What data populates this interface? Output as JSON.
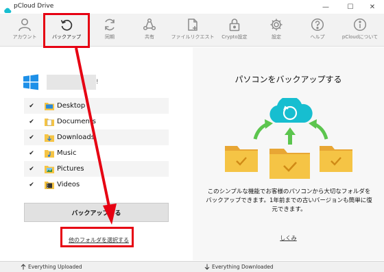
{
  "window": {
    "title": "pCloud Drive",
    "minimize": "—",
    "maximize": "☐",
    "close": "✕"
  },
  "toolbar": [
    {
      "label": "アカウント",
      "icon": "account-icon"
    },
    {
      "label": "バックアップ",
      "icon": "backup-icon"
    },
    {
      "label": "同期",
      "icon": "sync-icon"
    },
    {
      "label": "共有",
      "icon": "share-icon"
    },
    {
      "label": "ファイルリクエスト",
      "icon": "file-request-icon"
    },
    {
      "label": "Crypto設定",
      "icon": "crypto-icon"
    },
    {
      "label": "設定",
      "icon": "settings-icon"
    },
    {
      "label": "ヘルプ",
      "icon": "help-icon"
    },
    {
      "label": "pCloudについて",
      "icon": "info-icon"
    }
  ],
  "left": {
    "pc_name_tail": "!",
    "folders": [
      {
        "label": "Desktop",
        "checked": "✔"
      },
      {
        "label": "Documents",
        "checked": "✔"
      },
      {
        "label": "Downloads",
        "checked": "✔"
      },
      {
        "label": "Music",
        "checked": "✔"
      },
      {
        "label": "Pictures",
        "checked": "✔"
      },
      {
        "label": "Videos",
        "checked": "✔"
      }
    ],
    "backup_button": "バックアップする",
    "other_folder_link": "他のフォルダを選択する"
  },
  "right": {
    "title": "パソコンをバックアップする",
    "description": "このシンプルな機能でお客様のパソコンから大切なフォルダをバックアップできます。1年前までの古いバージョンも簡単に復元できます。",
    "learn_more": "しくみ"
  },
  "status": {
    "uploaded": "Everything Uploaded",
    "downloaded": "Everything Downloaded"
  },
  "colors": {
    "accent": "#17bed0",
    "folder": "#f5c445",
    "arrow_green": "#5cc54e",
    "annotation_red": "#e60012"
  }
}
